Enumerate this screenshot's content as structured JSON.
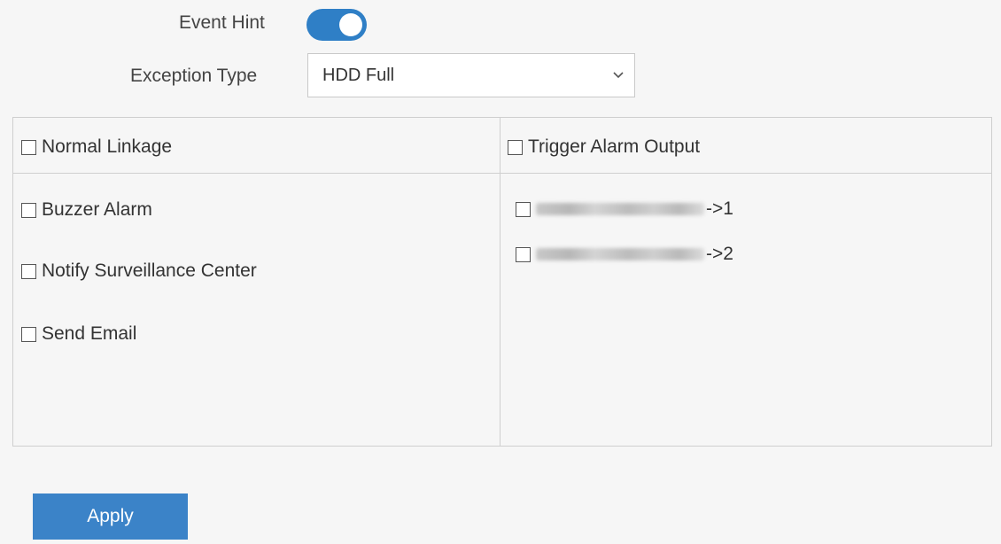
{
  "event_hint": {
    "label": "Event Hint",
    "enabled": true
  },
  "exception_type": {
    "label": "Exception Type",
    "selected": "HDD Full"
  },
  "linkage": {
    "normal_linkage_label": "Normal Linkage",
    "trigger_alarm_output_label": "Trigger Alarm Output",
    "normal_items": [
      {
        "label": "Buzzer Alarm",
        "checked": false
      },
      {
        "label": "Notify Surveillance Center",
        "checked": false
      },
      {
        "label": "Send Email",
        "checked": false
      }
    ],
    "alarm_outputs": [
      {
        "suffix": "->1",
        "checked": false
      },
      {
        "suffix": "->2",
        "checked": false
      }
    ]
  },
  "apply_label": "Apply",
  "colors": {
    "accent": "#3b83c8",
    "toggle": "#2f7fc6",
    "background": "#f6f6f6",
    "border": "#cfcfcf"
  },
  "icons": {
    "select_arrow": "chevron-down-icon"
  }
}
